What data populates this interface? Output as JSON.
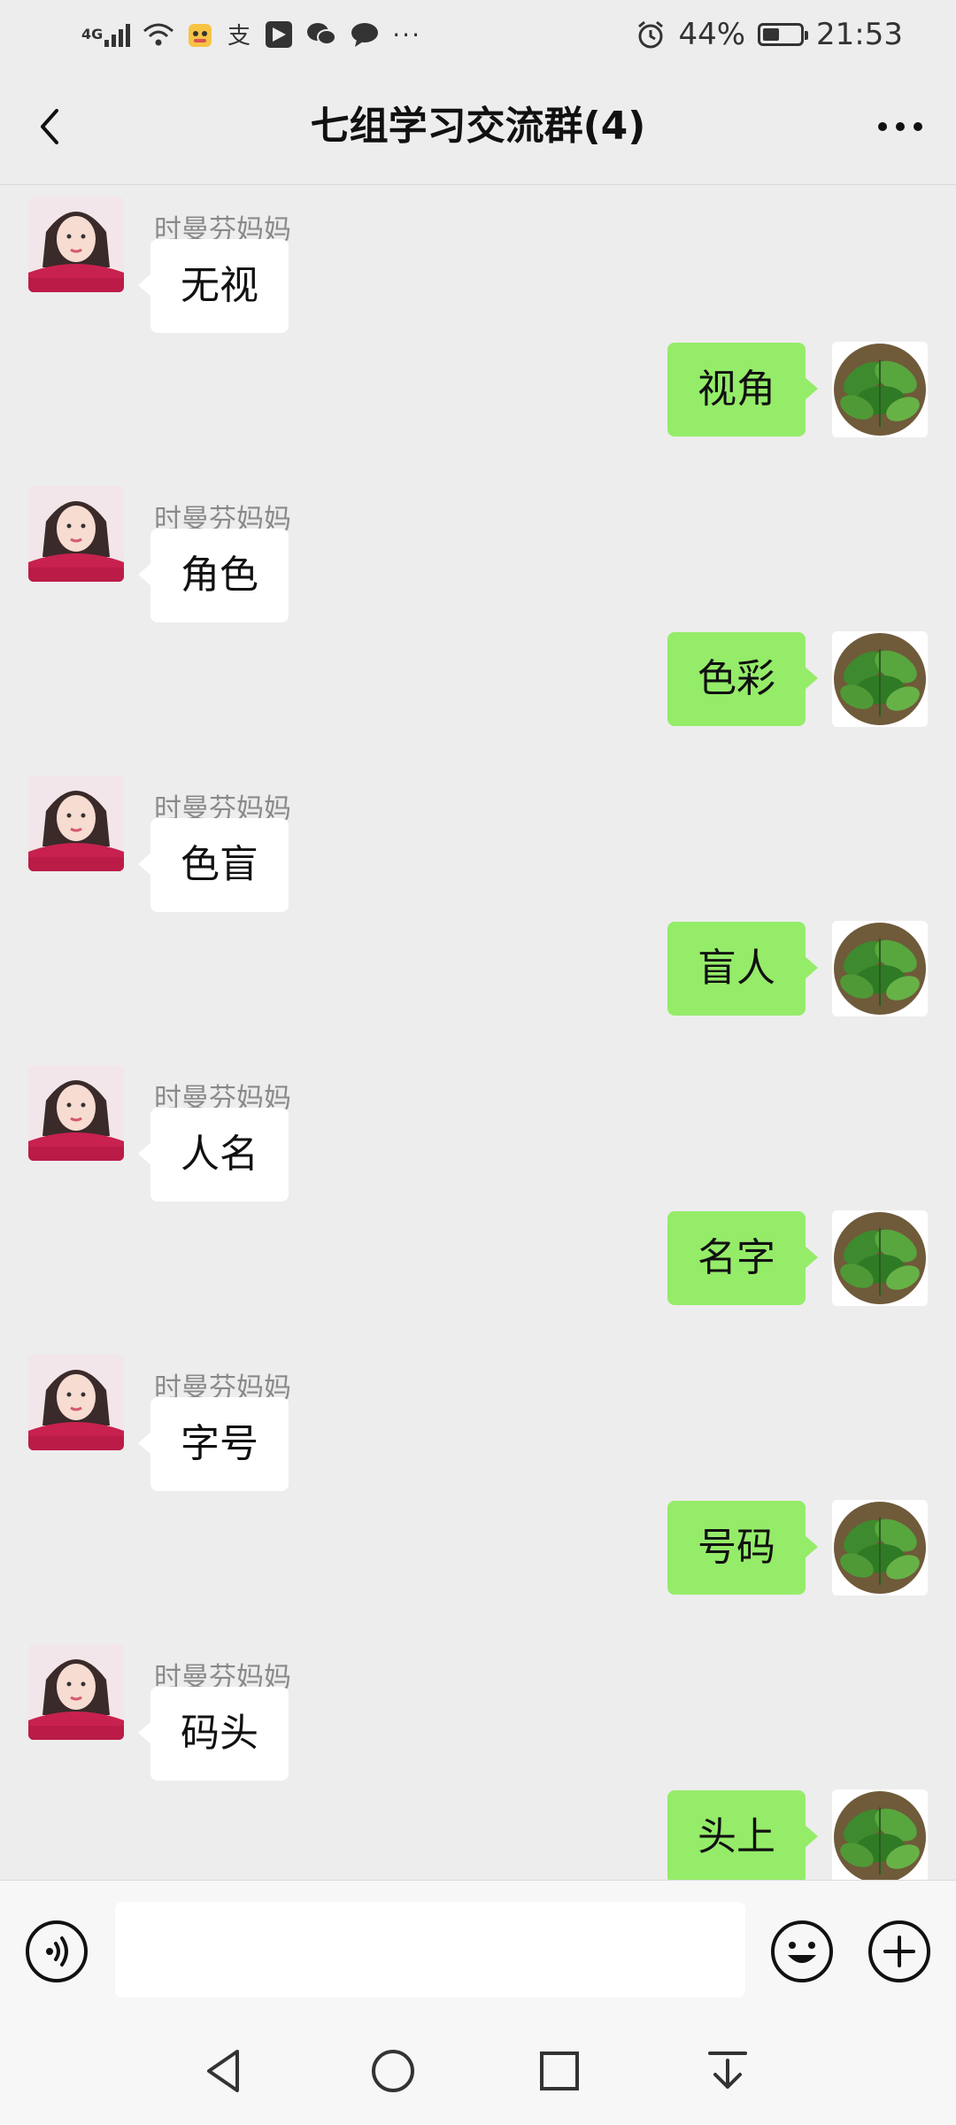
{
  "status_bar": {
    "network_label": "4G",
    "battery_percent": "44%",
    "battery_level": 0.44,
    "time": "21:53",
    "app_icons": [
      "signal-icon",
      "wifi-icon",
      "qq-pet-icon",
      "alipay-icon",
      "feishu-icon",
      "wechat-icon",
      "message-icon"
    ],
    "more_indicator": "···"
  },
  "header": {
    "title": "七组学习交流群(4)"
  },
  "messages": [
    {
      "side": "in",
      "sender": "时曼芬妈妈",
      "text": "无视"
    },
    {
      "side": "out",
      "text": "视角"
    },
    {
      "side": "in",
      "sender": "时曼芬妈妈",
      "text": "角色"
    },
    {
      "side": "out",
      "text": "色彩"
    },
    {
      "side": "in",
      "sender": "时曼芬妈妈",
      "text": "色盲"
    },
    {
      "side": "out",
      "text": "盲人"
    },
    {
      "side": "in",
      "sender": "时曼芬妈妈",
      "text": "人名"
    },
    {
      "side": "out",
      "text": "名字"
    },
    {
      "side": "in",
      "sender": "时曼芬妈妈",
      "text": "字号"
    },
    {
      "side": "out",
      "text": "号码"
    },
    {
      "side": "in",
      "sender": "时曼芬妈妈",
      "text": "码头"
    },
    {
      "side": "out",
      "text": "头上"
    }
  ],
  "input_bar": {
    "value": "",
    "placeholder": ""
  },
  "colors": {
    "background": "#EDEDED",
    "incoming_bubble": "#FFFFFF",
    "outgoing_bubble": "#95EC69",
    "sender_name": "#8A8A8A"
  }
}
